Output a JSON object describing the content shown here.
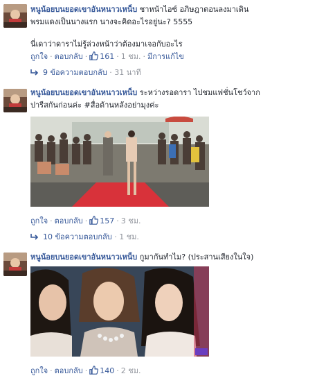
{
  "comments": [
    {
      "author": "หนูน้อยบนยอดเขาอันหนาวเหน็บ",
      "line1": " ชาหน้าไอซ์ อภิษฎาตอนลงมาเดิน",
      "line2": "พรมแดงเป็นนางแรก นางจะคิดอะไรอยู่นะ? 5555",
      "line3": "นี่เดาว่าดาราไม่รู้ล่วงหน้าว่าต้องมาเจอกับอะไร",
      "like": "ถูกใจ",
      "reply": "ตอบกลับ",
      "likes": "161",
      "time": "1 ชม.",
      "edited": "มีการแก้ไข",
      "reply_count": "9 ข้อความตอบกลับ",
      "reply_time": "31 นาที"
    },
    {
      "author": "หนูน้อยบนยอดเขาอันหนาวเหน็บ",
      "line1": " ระหว่างรอดารา ไปชมแฟชั่นโชว์จาก",
      "line2": "ปารีสกันก่อนค่ะ #สื่อด้านหลังอย่ามุงค่ะ",
      "like": "ถูกใจ",
      "reply": "ตอบกลับ",
      "likes": "157",
      "time": "3 ชม.",
      "reply_count": "10 ข้อความตอบกลับ",
      "reply_time": "1 ชม."
    },
    {
      "author": "หนูน้อยบนยอดเขาอันหนาวเหน็บ",
      "line1": " กูมากันทำไม? (ประสานเสียงในใจ)",
      "like": "ถูกใจ",
      "reply": "ตอบกลับ",
      "likes": "140",
      "time": "2 ชม."
    }
  ],
  "colors": {
    "link": "#365899",
    "meta": "#90949c",
    "text": "#1d2129"
  },
  "icons": {
    "like": "thumbs-up-icon",
    "reply": "reply-arrow-icon"
  }
}
